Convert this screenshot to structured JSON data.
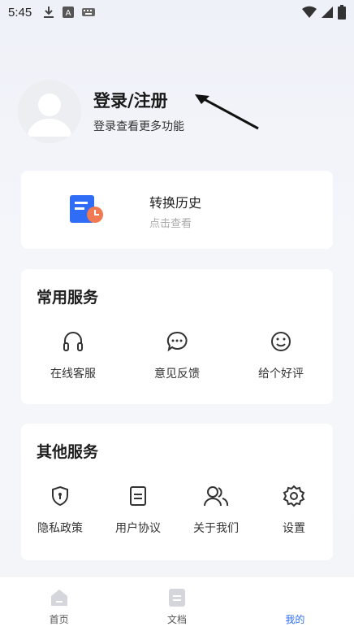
{
  "status_bar": {
    "time": "5:45"
  },
  "profile": {
    "title": "登录/注册",
    "subtitle": "登录查看更多功能"
  },
  "history": {
    "title": "转换历史",
    "subtitle": "点击查看"
  },
  "common_services": {
    "title": "常用服务",
    "items": [
      {
        "label": "在线客服",
        "icon": "headset-icon"
      },
      {
        "label": "意见反馈",
        "icon": "chat-bubble-icon"
      },
      {
        "label": "给个好评",
        "icon": "smile-icon"
      }
    ]
  },
  "other_services": {
    "title": "其他服务",
    "items": [
      {
        "label": "隐私政策",
        "icon": "shield-icon"
      },
      {
        "label": "用户协议",
        "icon": "document-icon"
      },
      {
        "label": "关于我们",
        "icon": "users-icon"
      },
      {
        "label": "设置",
        "icon": "gear-icon"
      }
    ]
  },
  "bottom_nav": {
    "items": [
      {
        "label": "首页",
        "icon": "home-icon"
      },
      {
        "label": "文档",
        "icon": "doc-icon"
      },
      {
        "label": "我的",
        "icon": "profile-icon"
      }
    ],
    "active": "我的"
  },
  "colors": {
    "accent": "#2f6df6",
    "history_icon_blue": "#2f6df6",
    "history_icon_orange": "#f27a52"
  }
}
